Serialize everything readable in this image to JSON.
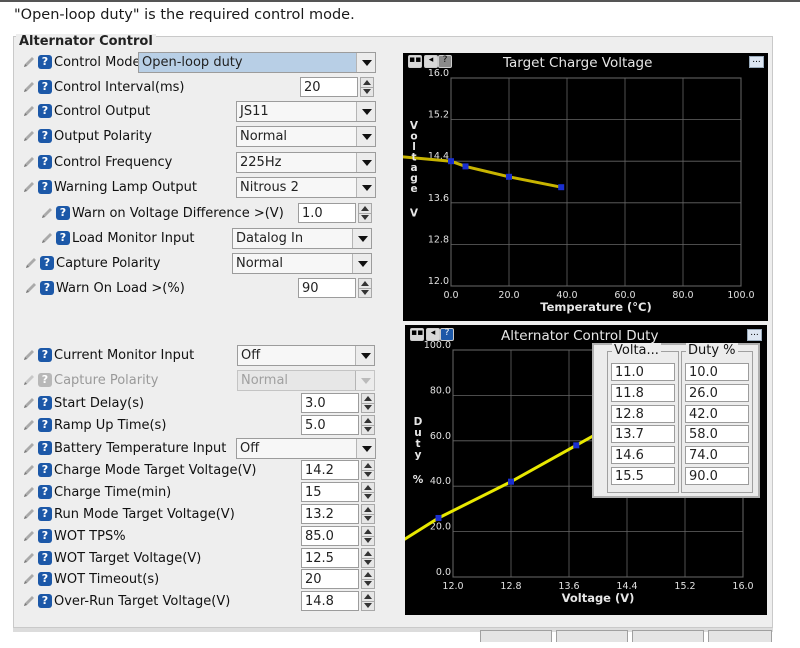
{
  "caption": "\"Open-loop duty\" is the required control mode.",
  "panel_title": "Alternator Control",
  "upper_rows": [
    {
      "label": "Control Mode",
      "type": "combo",
      "value": "Open-loop duty",
      "selected": true
    },
    {
      "label": "Control Interval(ms)",
      "type": "spin",
      "value": "20"
    },
    {
      "label": "Control Output",
      "type": "combo",
      "value": "JS11"
    },
    {
      "label": "Output Polarity",
      "type": "combo",
      "value": "Normal"
    },
    {
      "label": "Control Frequency",
      "type": "combo",
      "value": "225Hz"
    },
    {
      "label": "Warning Lamp Output",
      "type": "combo",
      "value": "Nitrous 2"
    },
    {
      "label": "Warn on Voltage Difference >(V)",
      "type": "spin",
      "value": "1.0"
    },
    {
      "label": "Load Monitor Input",
      "type": "combo",
      "value": "Datalog In"
    },
    {
      "label": "Capture Polarity",
      "type": "combo",
      "value": "Normal"
    },
    {
      "label": "Warn On Load >(%)",
      "type": "spin",
      "value": "90"
    }
  ],
  "lower_rows": [
    {
      "label": "Current Monitor Input",
      "type": "combo",
      "value": "Off"
    },
    {
      "label": "Capture Polarity",
      "type": "combo",
      "value": "Normal",
      "disabled": true
    },
    {
      "label": "Start Delay(s)",
      "type": "spin",
      "value": "3.0"
    },
    {
      "label": "Ramp Up Time(s)",
      "type": "spin",
      "value": "5.0"
    },
    {
      "label": "Battery Temperature Input",
      "type": "combo",
      "value": "Off"
    },
    {
      "label": "Charge Mode Target Voltage(V)",
      "type": "spin",
      "value": "14.2"
    },
    {
      "label": "Charge Time(min)",
      "type": "spin",
      "value": "15"
    },
    {
      "label": "Run Mode Target Voltage(V)",
      "type": "spin",
      "value": "13.2"
    },
    {
      "label": "WOT TPS%",
      "type": "spin",
      "value": "85.0"
    },
    {
      "label": "WOT Target Voltage(V)",
      "type": "spin",
      "value": "12.5"
    },
    {
      "label": "WOT Timeout(s)",
      "type": "spin",
      "value": "20"
    },
    {
      "label": "Over-Run Target Voltage(V)",
      "type": "spin",
      "value": "14.8"
    }
  ],
  "colors": {
    "panel_bg": "#eeeeee",
    "help_icon": "#1c58a8",
    "line_color": "#c8b400",
    "duty_line": "#e8e800",
    "point_color": "#1a2fd0"
  },
  "chart_data": [
    {
      "type": "line",
      "title": "Target Charge Voltage",
      "xlabel": "Temperature (°C)",
      "ylabel": "Voltage V",
      "ylabel_letters": [
        "V",
        "o",
        "l",
        "t",
        "a",
        "g",
        "e"
      ],
      "ylabel_unit": "V",
      "xlim": [
        0,
        100
      ],
      "ylim": [
        12.0,
        16.0
      ],
      "xticks": [
        "0.0",
        "20.0",
        "40.0",
        "60.0",
        "80.0",
        "100.0"
      ],
      "yticks": [
        "12.0",
        "12.8",
        "13.6",
        "14.4",
        "15.2",
        "16.0"
      ],
      "grid": true,
      "series": [
        {
          "x": [
            -20,
            0,
            5,
            20,
            38
          ],
          "y": [
            14.5,
            14.4,
            14.3,
            14.1,
            13.9
          ],
          "points": [
            [
              0,
              14.4
            ],
            [
              5,
              14.3
            ],
            [
              20,
              14.1
            ],
            [
              38,
              13.9
            ]
          ]
        }
      ]
    },
    {
      "type": "line",
      "title": "Alternator Control Duty",
      "xlabel": "Voltage (V)",
      "ylabel": "Duty %",
      "ylabel_letters": [
        "D",
        "u",
        "t",
        "y"
      ],
      "ylabel_unit": "%",
      "xlim": [
        12.0,
        16.0
      ],
      "ylim": [
        0.0,
        100.0
      ],
      "xticks": [
        "12.0",
        "12.8",
        "13.6",
        "14.4",
        "15.2",
        "16.0"
      ],
      "yticks": [
        "0.0",
        "20.0",
        "40.0",
        "60.0",
        "80.0",
        "100.0"
      ],
      "grid": true,
      "table": {
        "headers": [
          "Volta...",
          "Duty %"
        ],
        "voltage": [
          "11.0",
          "11.8",
          "12.8",
          "13.7",
          "14.6",
          "15.5"
        ],
        "duty": [
          "10.0",
          "26.0",
          "42.0",
          "58.0",
          "74.0",
          "90.0"
        ]
      },
      "series": [
        {
          "x": [
            11.0,
            11.8,
            12.8,
            13.7,
            14.6,
            15.5
          ],
          "y": [
            10,
            26,
            42,
            58,
            74,
            90
          ]
        }
      ]
    }
  ]
}
